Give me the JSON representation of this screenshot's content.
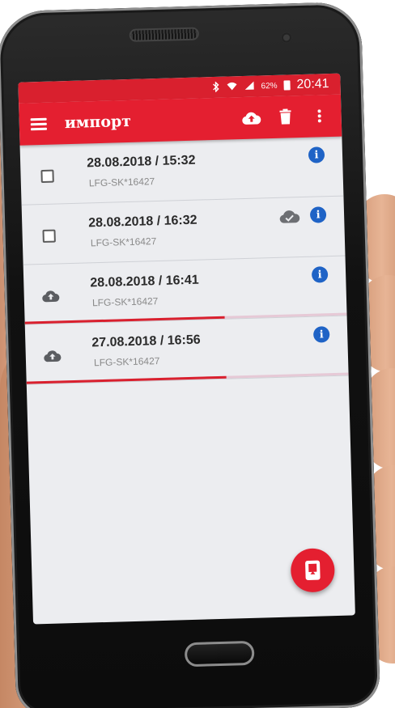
{
  "status_bar": {
    "bluetooth_icon": "bluetooth-icon",
    "wifi_icon": "wifi-icon",
    "signal_icon": "signal-icon",
    "battery_percent": "62%",
    "time": "20:41"
  },
  "app_bar": {
    "title": "импорт",
    "menu_icon": "hamburger-menu-icon",
    "actions": [
      "cloud-upload-icon",
      "trash-icon",
      "more-vert-icon"
    ]
  },
  "colors": {
    "primary": "#e41f30",
    "status_bar": "#d9202e",
    "info": "#1f63c6",
    "background": "#ecedf0"
  },
  "items": [
    {
      "datetime": "28.08.2018 / 15:32",
      "device_id": "LFG-SK*16427",
      "lead": "checkbox",
      "uploaded": false,
      "progress": null
    },
    {
      "datetime": "28.08.2018 / 16:32",
      "device_id": "LFG-SK*16427",
      "lead": "checkbox",
      "uploaded": true,
      "progress": null
    },
    {
      "datetime": "28.08.2018 / 16:41",
      "device_id": "LFG-SK*16427",
      "lead": "cloud-upload",
      "uploaded": false,
      "progress": 0.62
    },
    {
      "datetime": "27.08.2018 / 16:56",
      "device_id": "LFG-SK*16427",
      "lead": "cloud-upload",
      "uploaded": false,
      "progress": 0.62
    }
  ],
  "fab": {
    "icon": "device-import-icon"
  }
}
